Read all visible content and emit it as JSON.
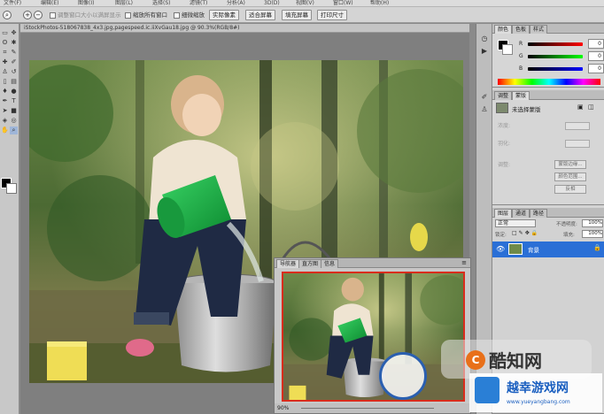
{
  "menu": {
    "items": [
      "文件(F)",
      "编辑(E)",
      "图像(I)",
      "图层(L)",
      "选择(S)",
      "滤镜(T)",
      "分析(A)",
      "3D(D)",
      "视图(V)",
      "窗口(W)",
      "帮助(H)"
    ]
  },
  "options_bar": {
    "resize_window": "调整窗口大小以满屏显示",
    "zoom_all": "缩放所有窗口",
    "scrubby_zoom": "细微缩放",
    "actual_pixels": "实际像素",
    "fit_screen": "适合屏幕",
    "fill_screen": "填充屏幕",
    "print_size": "打印尺寸"
  },
  "document": {
    "title": "iStockPhotos-518067838_4x3.jpg,pagespeed.ic.iiXvGau18.jpg @ 90.3%(RGB/8#)"
  },
  "navigator": {
    "tabs": [
      "导航器",
      "直方图",
      "信息"
    ],
    "zoom": "90%"
  },
  "color_panel": {
    "tabs": [
      "颜色",
      "色板",
      "样式"
    ],
    "channels": [
      {
        "label": "R",
        "value": "0"
      },
      {
        "label": "G",
        "value": "0"
      },
      {
        "label": "B",
        "value": "0"
      }
    ]
  },
  "adjust_panel": {
    "tabs": [
      "调整",
      "蒙版"
    ],
    "title": "未选择蒙版",
    "density": "浓度:",
    "feather": "羽化:",
    "refine": "调整:",
    "mask_edge": "蒙版边缘...",
    "color_range": "颜色范围...",
    "invert": "反相"
  },
  "layers_panel": {
    "tabs": [
      "图层",
      "通道",
      "路径"
    ],
    "blend_mode": "正常",
    "opacity_label": "不透明度:",
    "opacity": "100%",
    "lock_label": "锁定:",
    "fill_label": "填充:",
    "fill": "100%",
    "layer_name": "背景"
  },
  "watermarks": {
    "site1": "酷知网",
    "site2_title": "越幸游戏网",
    "site2_url": "www.yueyangbang.com"
  },
  "colors": {
    "accent_selection": "#2a6fd6",
    "navigator_frame": "#d92c1c",
    "bucket_green": "#1fae43"
  }
}
